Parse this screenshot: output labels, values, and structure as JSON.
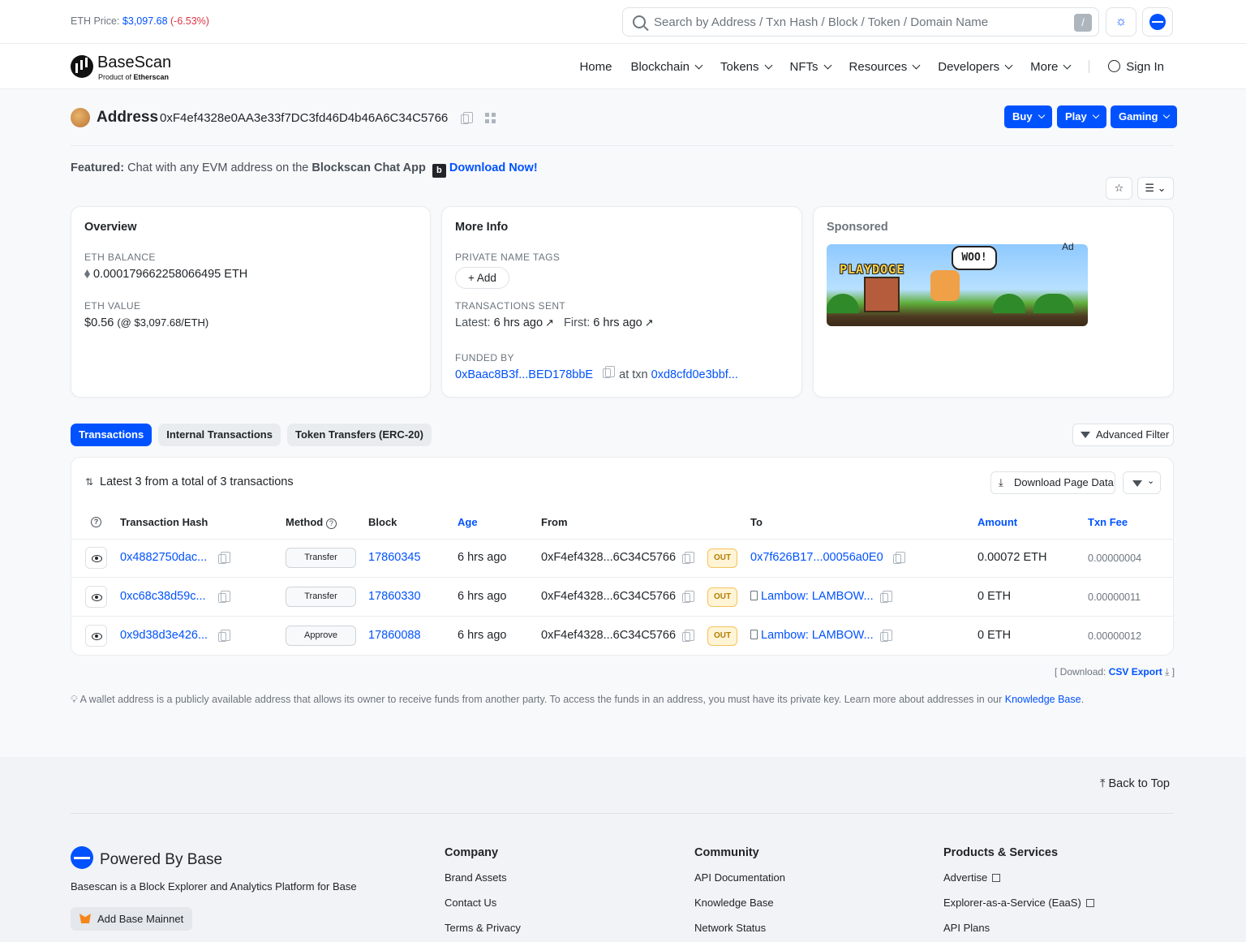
{
  "topbar": {
    "eth_price_label": "ETH Price:",
    "eth_price_value": "$3,097.68",
    "eth_price_change": "(-6.53%)",
    "search_placeholder": "Search by Address / Txn Hash / Block / Token / Domain Name",
    "search_shortcut": "/"
  },
  "brand": {
    "name": "BaseScan",
    "sub_prefix": "Product of ",
    "sub_brand": "Etherscan"
  },
  "nav": {
    "items": [
      "Home",
      "Blockchain",
      "Tokens",
      "NFTs",
      "Resources",
      "Developers",
      "More"
    ],
    "sign_in": "Sign In"
  },
  "address": {
    "label": "Address",
    "value": "0xF4ef4328e0AA3e33f7DC3fd46D4b46A6C34C5766",
    "buttons": [
      "Buy",
      "Play",
      "Gaming"
    ]
  },
  "featured": {
    "prefix": "Featured:",
    "text": "Chat with any EVM address on the",
    "app": "Blockscan Chat App",
    "icon_letter": "b",
    "cta": "Download Now!"
  },
  "overview": {
    "title": "Overview",
    "balance_label": "ETH BALANCE",
    "balance_value": "0.000179662258066495 ETH",
    "value_label": "ETH VALUE",
    "value_main": "$0.56",
    "value_rate": "(@ $3,097.68/ETH)"
  },
  "more_info": {
    "title": "More Info",
    "tags_label": "PRIVATE NAME TAGS",
    "add_button": "+ Add",
    "sent_label": "TRANSACTIONS SENT",
    "latest_label": "Latest:",
    "latest_value": "6 hrs ago",
    "first_label": "First:",
    "first_value": "6 hrs ago",
    "funded_label": "FUNDED BY",
    "funded_address": "0xBaac8B3f...BED178bbE",
    "at_txn_label": "at txn",
    "funded_txn": "0xd8cfd0e3bbf..."
  },
  "sponsored": {
    "title": "Sponsored",
    "ad_tag": "Ad",
    "banner_logo": "PLAYDOGE",
    "banner_bubble": "WOO!"
  },
  "tabs": [
    "Transactions",
    "Internal Transactions",
    "Token Transfers (ERC-20)"
  ],
  "advanced_filter": "Advanced Filter",
  "transactions": {
    "summary": "Latest 3 from a total of 3 transactions",
    "download": "Download Page Data",
    "headers": {
      "hash": "Transaction Hash",
      "method": "Method",
      "block": "Block",
      "age": "Age",
      "from": "From",
      "to": "To",
      "amount": "Amount",
      "fee": "Txn Fee"
    },
    "rows": [
      {
        "hash": "0x4882750dac...",
        "method": "Transfer",
        "block": "17860345",
        "age": "6 hrs ago",
        "from": "0xF4ef4328...6C34C5766",
        "dir": "OUT",
        "to": "0x7f626B17...00056a0E0",
        "to_contract": false,
        "amount": "0.00072 ETH",
        "fee": "0.00000004"
      },
      {
        "hash": "0xc68c38d59c...",
        "method": "Transfer",
        "block": "17860330",
        "age": "6 hrs ago",
        "from": "0xF4ef4328...6C34C5766",
        "dir": "OUT",
        "to": "Lambow: LAMBOW...",
        "to_contract": true,
        "amount": "0 ETH",
        "fee": "0.00000011"
      },
      {
        "hash": "0x9d38d3e426...",
        "method": "Approve",
        "block": "17860088",
        "age": "6 hrs ago",
        "from": "0xF4ef4328...6C34C5766",
        "dir": "OUT",
        "to": "Lambow: LAMBOW...",
        "to_contract": true,
        "amount": "0 ETH",
        "fee": "0.00000012"
      }
    ]
  },
  "csv": {
    "prefix": "[ Download:",
    "link": "CSV Export",
    "suffix": "]"
  },
  "note": {
    "text": "A wallet address is a publicly available address that allows its owner to receive funds from another party. To access the funds in an address, you must have its private key. Learn more about addresses in our",
    "link": "Knowledge Base",
    "end": "."
  },
  "footer": {
    "back_to_top": "Back to Top",
    "powered": "Powered By Base",
    "desc": "Basescan is a Block Explorer and Analytics Platform for Base",
    "add_network": "Add Base Mainnet",
    "company": {
      "title": "Company",
      "items": [
        "Brand Assets",
        "Contact Us",
        "Terms & Privacy"
      ]
    },
    "community": {
      "title": "Community",
      "items": [
        "API Documentation",
        "Knowledge Base",
        "Network Status"
      ]
    },
    "products": {
      "title": "Products & Services",
      "items": [
        "Advertise",
        "Explorer-as-a-Service (EaaS)",
        "API Plans"
      ]
    }
  },
  "colors": {
    "accent": "#0052ff",
    "negative": "#dc3545",
    "out_badge": "#f5c35b"
  }
}
